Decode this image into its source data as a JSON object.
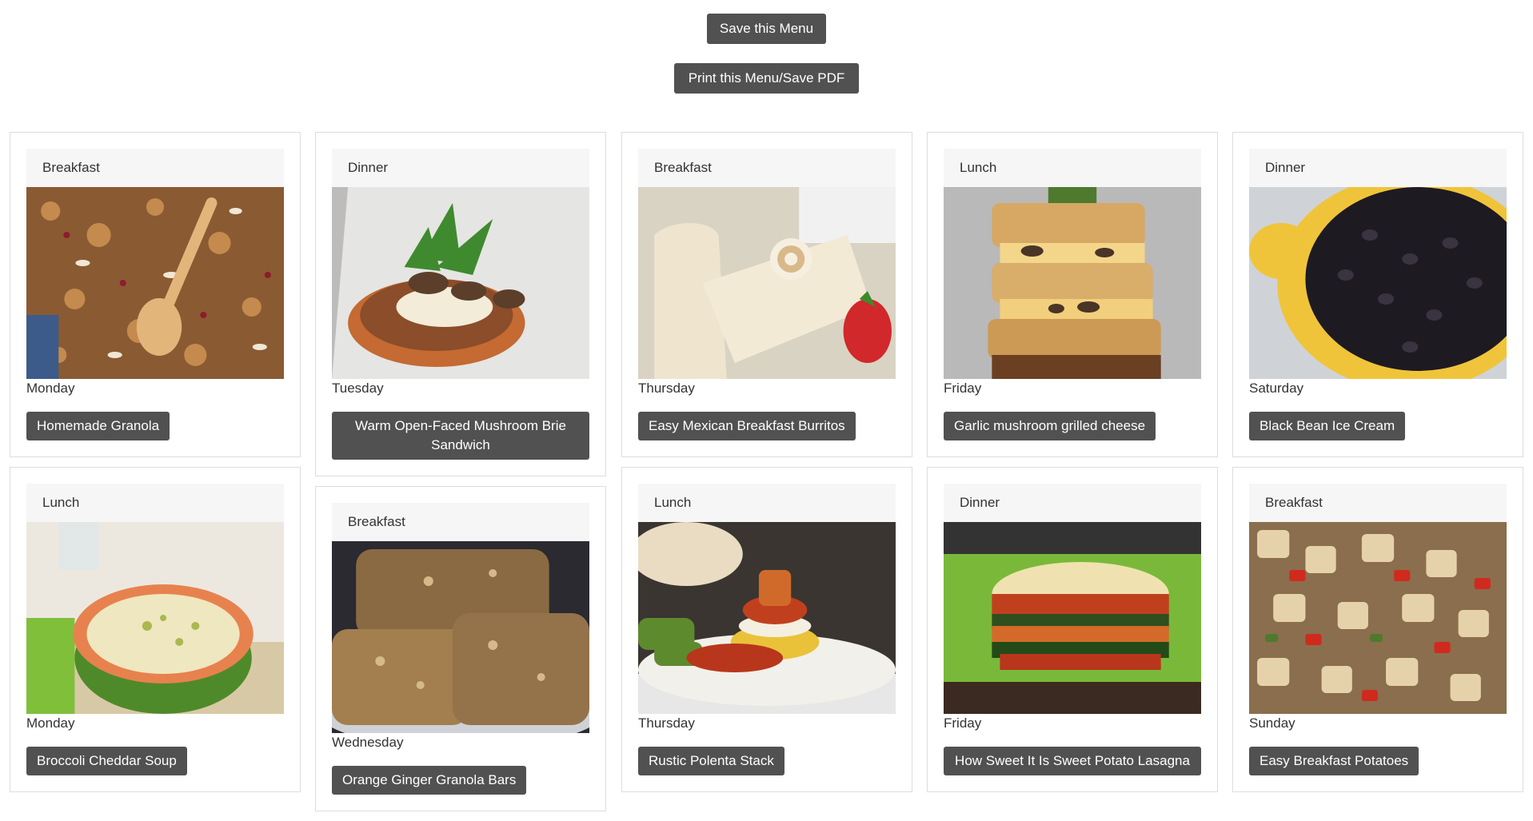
{
  "actions": {
    "save_label": "Save this Menu",
    "print_label": "Print this Menu/Save PDF"
  },
  "columns": [
    {
      "cards": [
        {
          "meal": "Breakfast",
          "day": "Monday",
          "recipe": "Homemade Granola",
          "photo": "granola-photo"
        },
        {
          "meal": "Lunch",
          "day": "Monday",
          "recipe": "Broccoli Cheddar Soup",
          "photo": "soup-photo"
        }
      ]
    },
    {
      "cards": [
        {
          "meal": "Dinner",
          "day": "Tuesday",
          "recipe": "Warm Open-Faced Mushroom Brie Sandwich",
          "photo": "mushroom-toast-photo"
        },
        {
          "meal": "Breakfast",
          "day": "Wednesday",
          "recipe": "Orange Ginger Granola Bars",
          "photo": "granola-bars-photo"
        }
      ]
    },
    {
      "cards": [
        {
          "meal": "Breakfast",
          "day": "Thursday",
          "recipe": "Easy Mexican Breakfast Burritos",
          "photo": "burritos-photo"
        },
        {
          "meal": "Lunch",
          "day": "Thursday",
          "recipe": "Rustic Polenta Stack",
          "photo": "polenta-photo"
        }
      ]
    },
    {
      "cards": [
        {
          "meal": "Lunch",
          "day": "Friday",
          "recipe": "Garlic mushroom grilled cheese",
          "photo": "grilled-cheese-photo"
        },
        {
          "meal": "Dinner",
          "day": "Friday",
          "recipe": "How Sweet It Is Sweet Potato Lasagna",
          "photo": "lasagna-photo"
        }
      ]
    },
    {
      "cards": [
        {
          "meal": "Dinner",
          "day": "Saturday",
          "recipe": "Black Bean Ice Cream",
          "photo": "black-beans-photo"
        },
        {
          "meal": "Breakfast",
          "day": "Sunday",
          "recipe": "Easy Breakfast Potatoes",
          "photo": "potatoes-photo"
        }
      ]
    }
  ]
}
